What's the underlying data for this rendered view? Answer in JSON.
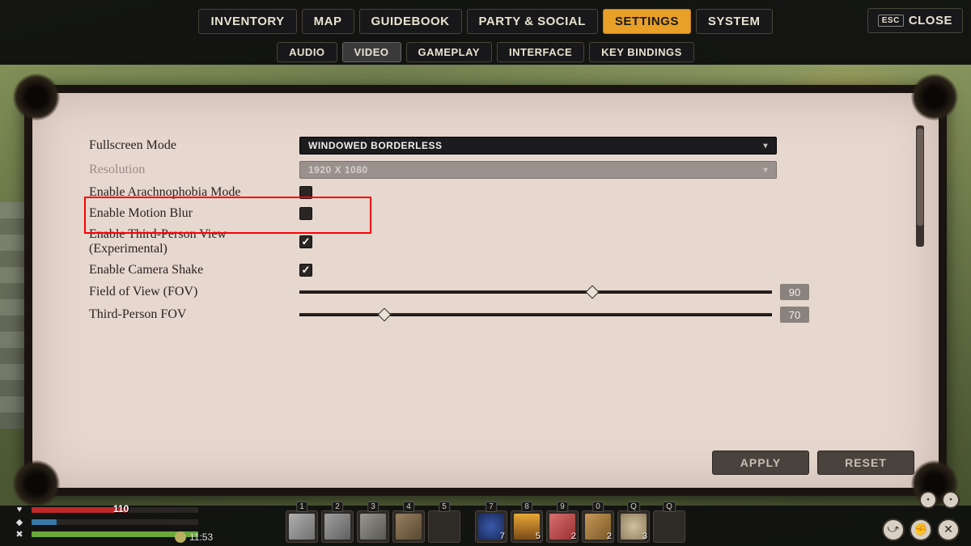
{
  "nav": {
    "items": [
      "INVENTORY",
      "MAP",
      "GUIDEBOOK",
      "PARTY & SOCIAL",
      "SETTINGS",
      "SYSTEM"
    ],
    "active_index": 4,
    "close": {
      "key": "ESC",
      "label": "CLOSE"
    }
  },
  "subnav": {
    "items": [
      "AUDIO",
      "VIDEO",
      "GAMEPLAY",
      "INTERFACE",
      "KEY BINDINGS"
    ],
    "selected_index": 1
  },
  "settings": {
    "fullscreen": {
      "label": "Fullscreen Mode",
      "value": "WINDOWED BORDERLESS"
    },
    "resolution": {
      "label": "Resolution",
      "value": "1920 X 1080",
      "enabled": false
    },
    "arachnophobia": {
      "label": "Enable Arachnophobia Mode",
      "checked": false,
      "highlighted": true
    },
    "motion_blur": {
      "label": "Enable Motion Blur",
      "checked": false
    },
    "third_person": {
      "label": "Enable Third-Person View (Experimental)",
      "checked": true
    },
    "camera_shake": {
      "label": "Enable Camera Shake",
      "checked": true
    },
    "fov": {
      "label": "Field of View (FOV)",
      "value": 90,
      "min": 60,
      "max": 120,
      "percent": 62
    },
    "tp_fov": {
      "label": "Third-Person FOV",
      "value": 70,
      "min": 60,
      "max": 120,
      "percent": 18
    }
  },
  "footer": {
    "apply": "APPLY",
    "reset": "RESET"
  },
  "hud": {
    "hp": {
      "value": 110,
      "percent": 58
    },
    "mp": {
      "percent": 15
    },
    "st": {
      "percent": 100
    },
    "clock": "11:53",
    "hotbar": [
      {
        "key": "1",
        "color": "#9a9a9a",
        "count": null,
        "name": "sword"
      },
      {
        "key": "2",
        "color": "#8a8a8a",
        "count": null,
        "name": "trident"
      },
      {
        "key": "3",
        "color": "#7a7a7a",
        "count": null,
        "name": "axe"
      },
      {
        "key": "4",
        "color": "#888070",
        "count": null,
        "name": "pickaxe"
      },
      {
        "key": "5",
        "color": null,
        "count": null,
        "name": "empty"
      },
      {
        "key": "7",
        "color": "#2a3a7a",
        "count": 7,
        "name": "berries"
      },
      {
        "key": "8",
        "color": "#8a5a2a",
        "count": 5,
        "name": "torch"
      },
      {
        "key": "9",
        "color": "#b86a6a",
        "count": 2,
        "name": "meat"
      },
      {
        "key": "0",
        "color": "#a87848",
        "count": 2,
        "name": "cooked-meat"
      },
      {
        "key": "Q",
        "color": "#b8a898",
        "count": 3,
        "name": "mushroom"
      },
      {
        "key": "Q",
        "color": null,
        "count": null,
        "name": "empty"
      }
    ]
  }
}
